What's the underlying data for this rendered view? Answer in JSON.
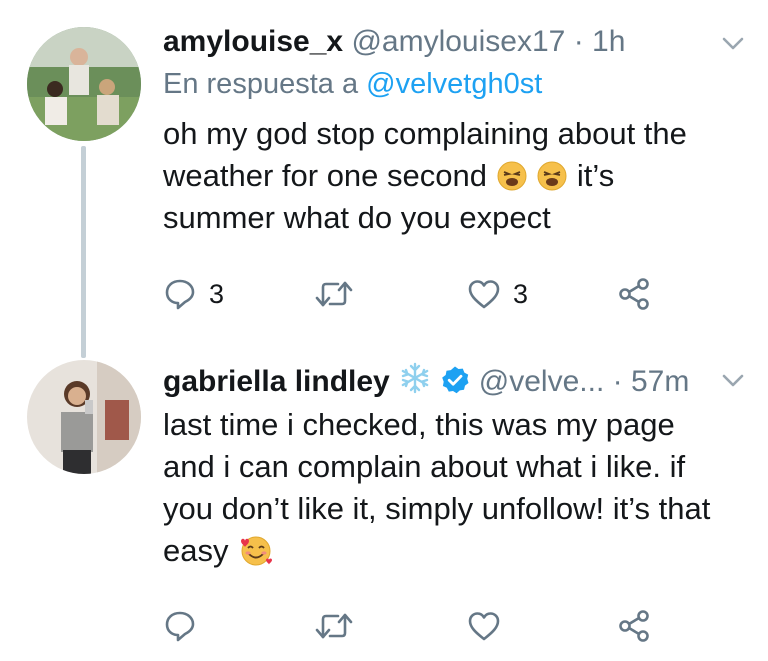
{
  "tweets": [
    {
      "display_name": "amylouise_x",
      "handle": "@amylouisex17",
      "separator": "·",
      "time": "1h",
      "reply_label": "En respuesta a",
      "reply_mention": "@velvetgh0st",
      "text_line1": "oh my god stop complaining about the",
      "text_line2_before": "weather for one second",
      "text_line2_after": "it’s",
      "text_line3": "summer what do you expect",
      "emojis": [
        "weary-face-emoji",
        "weary-face-emoji"
      ],
      "reply_count": "3",
      "retweet_count": "",
      "like_count": "3"
    },
    {
      "display_name": "gabriella lindley",
      "name_icons": [
        "snowflake-icon",
        "verified-badge-icon"
      ],
      "handle": "@velve...",
      "separator": "·",
      "time": "57m",
      "text_line1": "last time i checked, this was my page",
      "text_line2": "and i can complain about what i like. if",
      "text_line3": "you don’t like it, simply unfollow! it’s that",
      "text_line4": "easy",
      "emojis": [
        "smiling-face-with-hearts-emoji"
      ],
      "reply_count": "",
      "retweet_count": "",
      "like_count": ""
    }
  ],
  "colors": {
    "text": "#14171a",
    "secondary": "#657786",
    "link": "#1da1f2",
    "thread_line": "#c4cfd6",
    "verified": "#1da1f2"
  }
}
